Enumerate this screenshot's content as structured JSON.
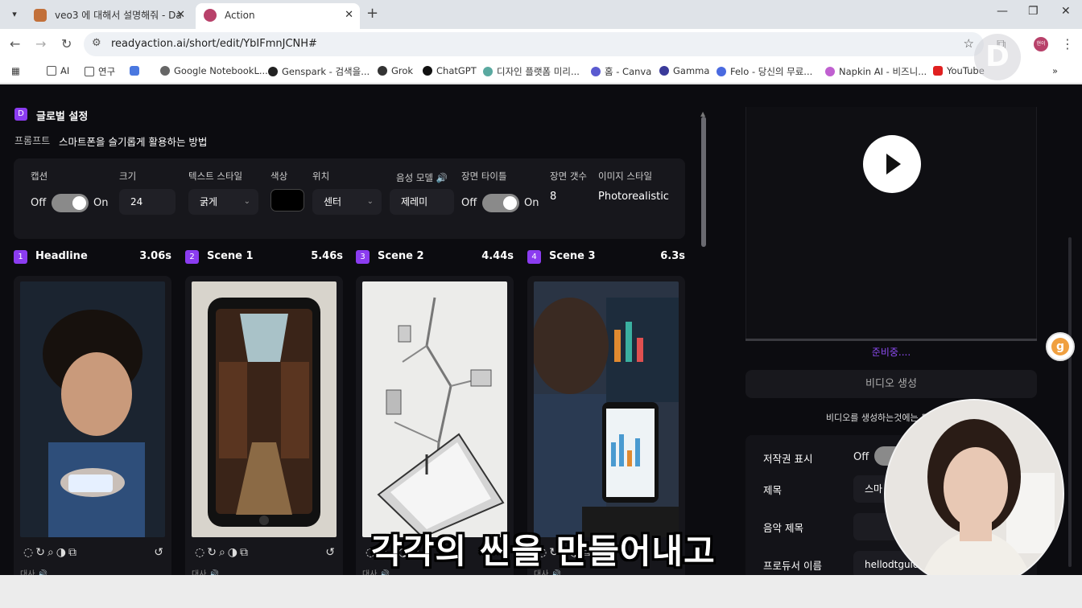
{
  "browser": {
    "tabs": [
      {
        "title": "veo3 에 대해서 설명해줘 - Da"
      },
      {
        "title": "Action"
      }
    ],
    "url": "readyaction.ai/short/edit/YbIFmnJCNH#",
    "bookmarks": [
      "AI",
      "연구",
      "Google NotebookL...",
      "Genspark - 검색을...",
      "Grok",
      "ChatGPT",
      "디자인 플랫폼 미리...",
      "홈 - Canva",
      "Gamma",
      "Felo - 당신의 무료...",
      "Napkin AI - 비즈니...",
      "YouTube"
    ],
    "profile": "현이"
  },
  "global_settings": {
    "badge": "D",
    "title": "글로벌 설정",
    "prompt_label": "프롬프트",
    "prompt_value": "스마트폰을 슬기롭게 활용하는 방법",
    "labels": {
      "caption": "캡션",
      "size": "크기",
      "text_style": "텍스트 스타일",
      "color": "색상",
      "position": "위치",
      "voice_model": "음성 모델",
      "scene_title": "장면 타이틀",
      "scene_count": "장면 갯수",
      "image_style": "이미지 스타일"
    },
    "caption_off": "Off",
    "caption_on": "On",
    "size_value": "24",
    "text_style_value": "굵게",
    "position_value": "센터",
    "voice_model_value": "제레미",
    "scene_title_off": "Off",
    "scene_title_on": "On",
    "scene_count_value": "8",
    "image_style_value": "Photorealistic",
    "caption_color": "#000000"
  },
  "scenes": [
    {
      "num": "1",
      "name": "Headline",
      "duration": "3.06s"
    },
    {
      "num": "2",
      "name": "Scene 1",
      "duration": "5.46s"
    },
    {
      "num": "3",
      "name": "Scene 2",
      "duration": "4.44s"
    },
    {
      "num": "4",
      "name": "Scene 3",
      "duration": "6.3s"
    }
  ],
  "scene_dialog_label": "대사",
  "preview": {
    "status": "준비중....",
    "generate_button": "비디오 생성",
    "notice": "비디오를 생성하는것에는 토큰이 차",
    "copyright_label": "저작권 표시",
    "copyright_value": "Off",
    "title_label": "제목",
    "title_value": "스마",
    "music_label": "음악 제목",
    "producer_label": "프로듀서 이름",
    "producer_value": "hellodtguid"
  },
  "subtitle_overlay": "각각의 씬을 만들어내고",
  "accent_color": "#8b3cf0"
}
